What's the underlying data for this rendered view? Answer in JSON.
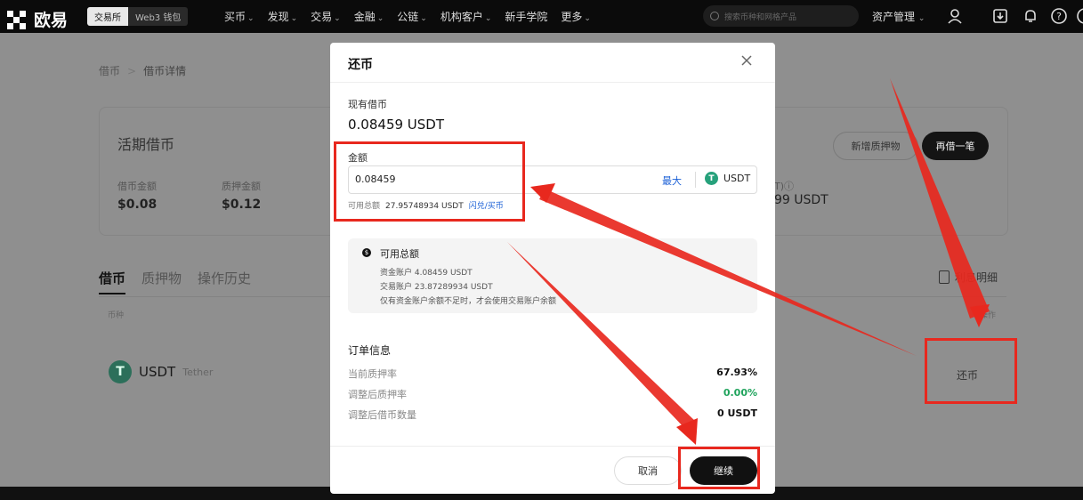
{
  "header": {
    "brand": "欧易",
    "switch": [
      "交易所",
      "Web3 钱包"
    ],
    "menu": [
      "买币",
      "发现",
      "交易",
      "金融",
      "公链",
      "机构客户",
      "新手学院",
      "更多"
    ],
    "search_placeholder": "搜索币种和网格产品",
    "asset_label": "资产管理"
  },
  "page": {
    "breadcrumb_root": "借币",
    "breadcrumb_current": "借币详情",
    "card_title": "活期借币",
    "stats": [
      {
        "label": "借币金额",
        "value": "$0.08"
      },
      {
        "label": "质押金额",
        "value": "$0.12"
      }
    ],
    "right_stat_label": "T)ⓘ",
    "right_stat_value": "99 USDT",
    "new_collateral_button": "新增质押物",
    "borrow_again_button": "再借一笔",
    "tabs": [
      "借币",
      "质押物",
      "操作历史"
    ],
    "interest_detail": "利息明细",
    "col_coin": "币种",
    "col_action": "操作",
    "row": {
      "coin": "USDT",
      "coin_full": "Tether",
      "action": "还币"
    }
  },
  "modal": {
    "title": "还币",
    "current_borrow_label": "现有借币",
    "current_borrow_value": "0.08459 USDT",
    "amount_label": "金额",
    "amount_value": "0.08459",
    "max_label": "最大",
    "currency": "USDT",
    "available_label": "可用总额",
    "available_value": "27.95748934 USDT",
    "available_link": "闪兑/买币",
    "info_title": "可用总额",
    "info_lines": [
      "资金账户 4.08459 USDT",
      "交易账户 23.87289934 USDT",
      "仅有资金账户余额不足时，才会使用交易账户余额"
    ],
    "order_info_title": "订单信息",
    "order_rows": [
      {
        "label": "当前质押率",
        "value": "67.93%"
      },
      {
        "label": "调整后质押率",
        "value": "0.00%"
      },
      {
        "label": "调整后借币数量",
        "value": "0 USDT"
      }
    ],
    "cancel_button": "取消",
    "continue_button": "继续"
  },
  "colors": {
    "annotation": "#e8281e",
    "link_blue": "#1a5fd6",
    "positive_green": "#1fa35c",
    "usdt_green": "#26a17b"
  },
  "icons": [
    "okx-logo-icon",
    "search-icon",
    "chevron-down-icon",
    "user-icon",
    "download-icon",
    "bell-icon",
    "help-icon",
    "close-icon",
    "usdt-icon",
    "info-icon",
    "document-icon"
  ]
}
